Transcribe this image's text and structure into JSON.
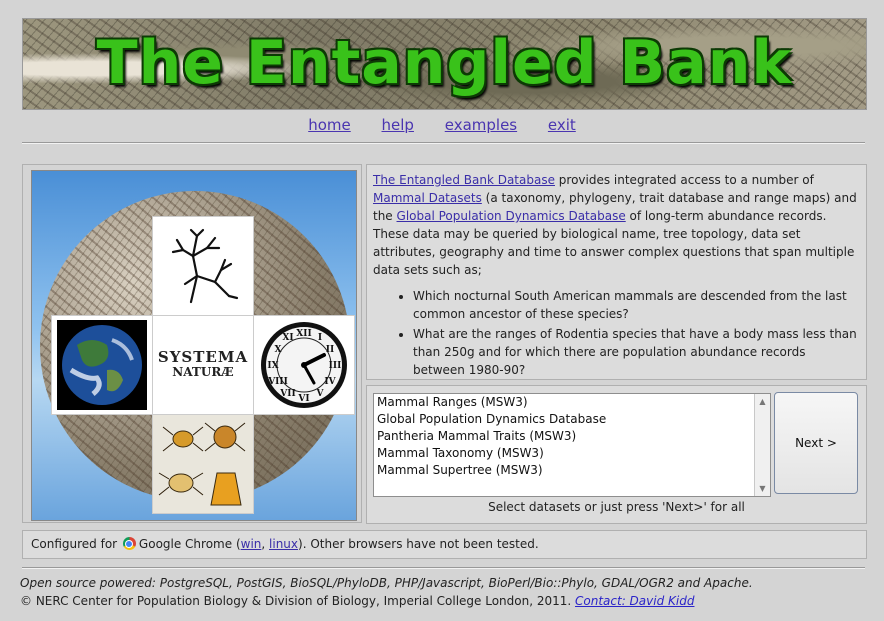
{
  "banner": {
    "title": "The Entangled Bank"
  },
  "nav": {
    "home": "home",
    "help": "help",
    "examples": "examples",
    "exit": "exit"
  },
  "image": {
    "systema_line1": "SYSTEMA",
    "systema_line2": "NATURÆ"
  },
  "description": {
    "link_db": "The Entangled Bank Database",
    "text1": " provides integrated access to a number of ",
    "link_mammal": "Mammal Datasets",
    "text2": " (a taxonomy, phylogeny, trait database and range maps) and the ",
    "link_gpdd": "Global Population Dynamics Database",
    "text3": " of long-term abundance records. These data may be queried by biological name, tree topology, data set attributes, geography and time to answer complex questions that span multiple data sets such as;",
    "examples": [
      "Which nocturnal South American mammals are descended from the last common ancestor of these species?",
      "What are the ranges of Rodentia species that have a body mass less than than 250g and for which there are population abundance records between 1980-90?"
    ]
  },
  "datasets": {
    "options": [
      "Mammal Ranges (MSW3)",
      "Global Population Dynamics Database",
      "Pantheria Mammal Traits (MSW3)",
      "Mammal Taxonomy (MSW3)",
      "Mammal Supertree (MSW3)"
    ],
    "next_label": "Next >",
    "hint": "Select datasets or just press 'Next>' for all"
  },
  "config": {
    "prefix": "Configured for",
    "browser": "Google Chrome",
    "open_paren": " (",
    "win": "win",
    "comma": ", ",
    "linux": "linux",
    "suffix": "). Other browsers have not been tested."
  },
  "footer": {
    "line1": "Open source powered: PostgreSQL, PostGIS, BioSQL/PhyloDB, PHP/Javascript, BioPerl/Bio::Phylo, GDAL/OGR2 and Apache.",
    "line2": "© NERC Center for Population Biology & Division of Biology, Imperial College London, 2011. ",
    "contact": "Contact: David Kidd"
  }
}
